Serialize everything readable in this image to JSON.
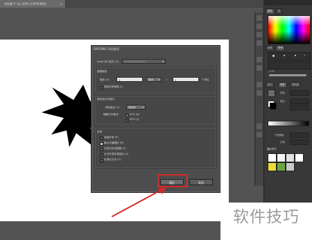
{
  "document": {
    "tab_title": "未标题-1* @ 146% (CMYK/预览)",
    "close_glyph": "×"
  },
  "right_panels": {
    "top_tabs": [
      "颜色",
      "颜"
    ],
    "brush_tabs": [
      "画笔",
      "符号"
    ],
    "brush_size": "5.00",
    "stroke_tabs": [
      "描边",
      "渐变",
      "透明度"
    ],
    "gradient_type_label": "类型",
    "stroke_label": "描边",
    "opacity_label": "不透明度",
    "location_label": "位置",
    "layers_title": "图形样式",
    "accent_color": "#d62a2a"
  },
  "dialog": {
    "title": "DXF/DWG 导出选项",
    "version_label": "AutoCAD 版本 (V)：",
    "version_value": "2004/2005/2006",
    "scale_group": "图稿缩放",
    "scale_label": "缩放 (S)：",
    "scale_value": "1",
    "unit_value": "毫米",
    "equals": "=",
    "unit_result_value": "1",
    "unit_result_label": "个单位",
    "scale_line_weight_label": "缩放线条粗细 (L)",
    "color_group": "颜色和文件格式",
    "color_count_label": "颜色数目 (C)：",
    "color_count_value": "真彩色",
    "raster_format_label": "栅格文件格式：",
    "format_png": "PNG (N)",
    "format_jpeg": "JPEG (J)",
    "options_group": "选项",
    "options": [
      {
        "label": "保留外观 (P)",
        "checked": false
      },
      {
        "label": "最大可编辑性 (M)",
        "checked": true
      },
      {
        "label": "仅导出所选图稿 (E)",
        "checked": false
      },
      {
        "label": "针对外观改变路径 (A)",
        "checked": false
      },
      {
        "label": "轮廓化文本 (O)",
        "checked": false
      }
    ],
    "ok_label": "确定",
    "cancel_label": "取消"
  },
  "annotation": {
    "highlight_color": "#d62a2a",
    "arrow_color": "#d62a2a"
  },
  "watermark": {
    "text": "软件技巧"
  }
}
